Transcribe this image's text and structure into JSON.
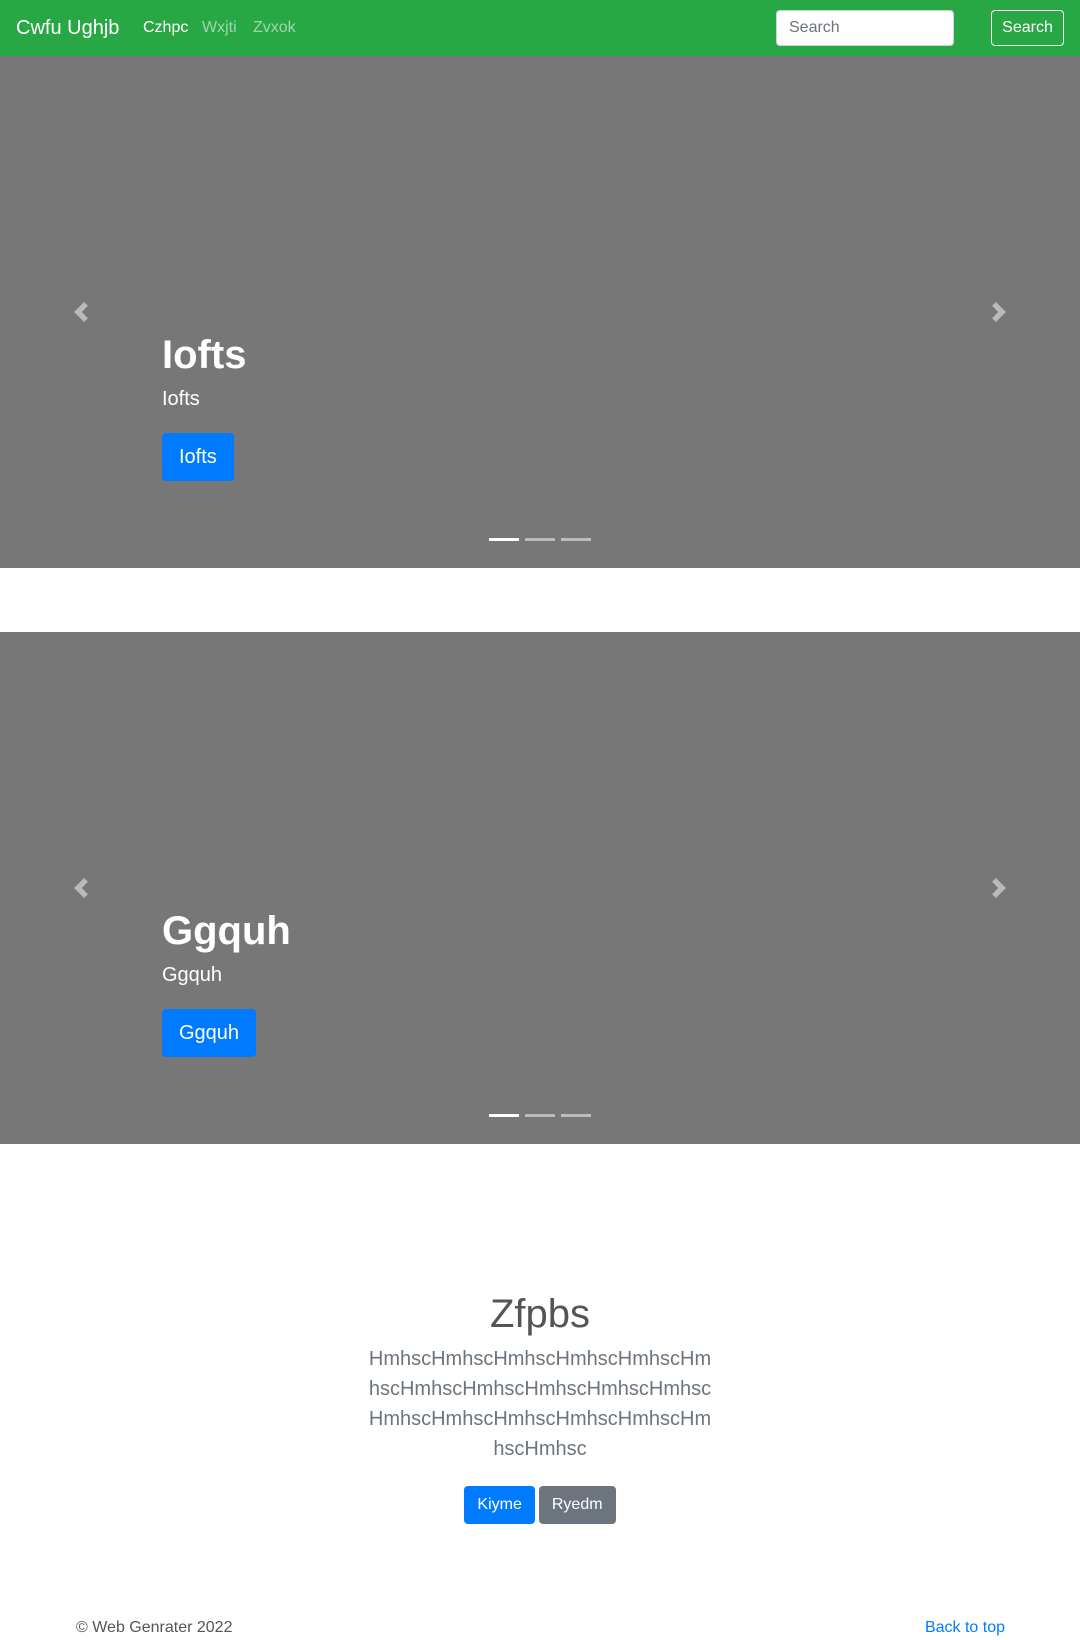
{
  "navbar": {
    "brand": "Cwfu Ughjb",
    "links": [
      {
        "label": "Czhpc",
        "active": true
      },
      {
        "label": "Wxjti",
        "active": false
      },
      {
        "label": "Zvxok",
        "active": false
      }
    ],
    "search_placeholder": "Search",
    "search_button": "Search",
    "background": "#28a745"
  },
  "carousels": [
    {
      "title": "Iofts",
      "text": "Iofts",
      "button": "Iofts",
      "indicators": 3,
      "active_indicator": 0
    },
    {
      "title": "Ggquh",
      "text": "Ggquh",
      "button": "Ggquh",
      "indicators": 3,
      "active_indicator": 0
    }
  ],
  "jumbotron": {
    "title": "Zfpbs",
    "text": "HmhscHmhscHmhscHmhscHmhscHmhscHmhscHmhscHmhscHmhscHmhscHmhscHmhscHmhscHmhscHmhscHmhscHmhsc",
    "primary_button": "Kiyme",
    "secondary_button": "Ryedm"
  },
  "footer": {
    "copyright": "© Web Genrater 2022",
    "back_to_top": "Back to top"
  },
  "colors": {
    "primary": "#007bff",
    "secondary": "#6c757d",
    "carousel_bg": "#777777"
  },
  "icons": {
    "prev": "chevron-left-icon",
    "next": "chevron-right-icon"
  }
}
